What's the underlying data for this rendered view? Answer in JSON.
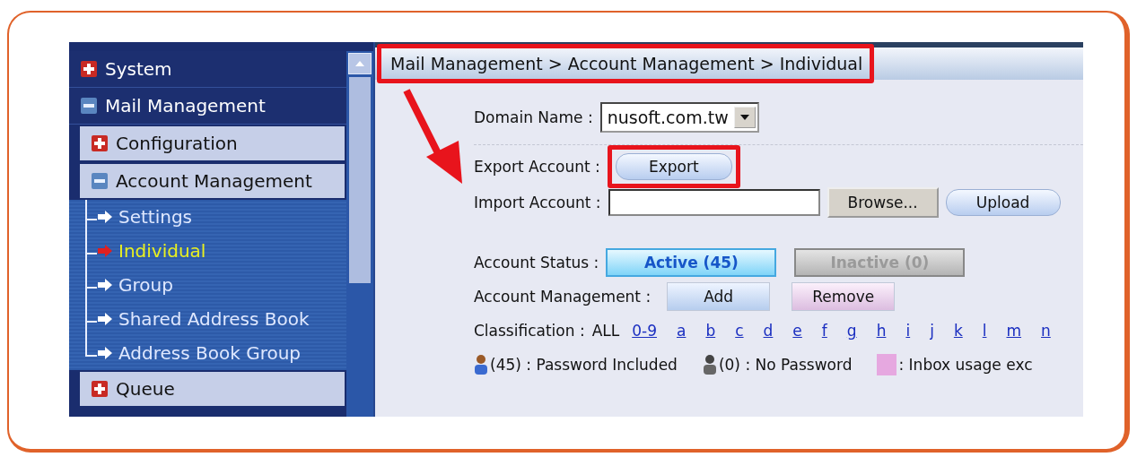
{
  "sidebar": {
    "items": [
      {
        "label": "System",
        "expanded": false
      },
      {
        "label": "Mail Management",
        "expanded": true,
        "children": [
          {
            "label": "Configuration",
            "expanded": false
          },
          {
            "label": "Account Management",
            "expanded": true,
            "children": [
              {
                "label": "Settings",
                "selected": false
              },
              {
                "label": "Individual",
                "selected": true
              },
              {
                "label": "Group",
                "selected": false
              },
              {
                "label": "Shared Address Book",
                "selected": false
              },
              {
                "label": "Address Book Group",
                "selected": false
              }
            ]
          },
          {
            "label": "Queue",
            "expanded": false
          }
        ]
      }
    ]
  },
  "breadcrumb": "Mail Management > Account Management > Individual",
  "domain_name": {
    "label": "Domain Name :",
    "value": "nusoft.com.tw"
  },
  "export_account": {
    "label": "Export Account :",
    "button": "Export"
  },
  "import_account": {
    "label": "Import Account :",
    "browse": "Browse...",
    "upload": "Upload"
  },
  "account_status": {
    "label": "Account Status :",
    "options": [
      {
        "label": "Active (45)",
        "selected": true
      },
      {
        "label": "Inactive (0)",
        "selected": false
      }
    ]
  },
  "account_management": {
    "label": "Account Management :",
    "buttons": [
      {
        "label": "Add",
        "kind": "add"
      },
      {
        "label": "Remove",
        "kind": "remove"
      }
    ]
  },
  "classification": {
    "label": "Classification :",
    "current": "ALL",
    "links": [
      "0-9",
      "a",
      "b",
      "c",
      "d",
      "e",
      "f",
      "g",
      "h",
      "i",
      "j",
      "k",
      "l",
      "m",
      "n"
    ]
  },
  "legend": [
    {
      "kind": "password",
      "text": "(45) : Password Included"
    },
    {
      "kind": "no-password",
      "text": "(0) : No Password"
    },
    {
      "kind": "swatch",
      "color": "#e6a8e0",
      "text": ": Inbox usage exc"
    }
  ]
}
